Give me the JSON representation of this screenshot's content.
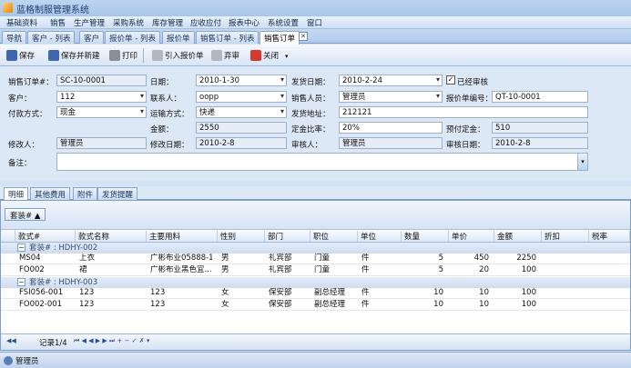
{
  "app": {
    "title": "蓝格制服管理系统"
  },
  "menu": [
    "基础资料",
    "销售",
    "生产管理",
    "采购系统",
    "库存管理",
    "应收应付",
    "报表中心",
    "系统设置",
    "窗口"
  ],
  "tabs": [
    "导航",
    "客户 - 列表",
    "客户",
    "报价单 - 列表",
    "报价单",
    "销售订单 - 列表",
    "销售订单"
  ],
  "toolbar": {
    "save": "保存",
    "save_new": "保存并新建",
    "print": "打印",
    "import_quote": "引入报价单",
    "audit": "弃审",
    "close": "关闭"
  },
  "form": {
    "order_no_label": "销售订单#：",
    "order_no": "SC-10-0001",
    "date_label": "日期：",
    "date": "2010-1-30",
    "ship_date_label": "发货日期：",
    "ship_date": "2010-2-24",
    "audited_label": "已经审核",
    "audited_check": "✓",
    "customer_label": "客户：",
    "customer": "112",
    "contact_label": "联系人：",
    "contact": "oopp",
    "salesman_label": "销售人员：",
    "salesman": "管理员",
    "quote_no_label": "报价单编号：",
    "quote_no": "QT-10-0001",
    "payment_label": "付款方式：",
    "payment": "现金",
    "transport_label": "运输方式：",
    "transport": "快递",
    "ship_addr_label": "发货地址：",
    "ship_addr": "212121",
    "amount_label": "金额：",
    "amount": "2550",
    "deposit_ratio_label": "定金比率：",
    "deposit_ratio": "20%",
    "prepaid_label": "预付定金：",
    "prepaid": "510",
    "modifier_label": "修改人：",
    "modifier": "管理员",
    "modify_date_label": "修改日期：",
    "modify_date": "2010-2-8",
    "auditor_label": "审核人：",
    "auditor": "管理员",
    "audit_date_label": "审核日期：",
    "audit_date": "2010-2-8",
    "remark_label": "备注："
  },
  "subtabs": [
    "明细",
    "其他费用",
    "附件",
    "发货提醒"
  ],
  "grid": {
    "group_chip": "套装# ▲",
    "columns": [
      "款式#",
      "款式名称",
      "主要用料",
      "性别",
      "部门",
      "职位",
      "单位",
      "数量",
      "单价",
      "金额",
      "折扣",
      "税率"
    ],
    "groups": [
      {
        "label": "套装# : HDHY-002",
        "rows": [
          [
            "MS04",
            "上衣",
            "广彬布业05888-1...",
            "男",
            "礼宾部",
            "门童",
            "件",
            "5",
            "450",
            "2250",
            "",
            ""
          ],
          [
            "FO002",
            "裙",
            "广彬布业黑色宜...",
            "男",
            "礼宾部",
            "门童",
            "件",
            "5",
            "20",
            "100",
            "",
            ""
          ]
        ]
      },
      {
        "label": "套装# : HDHY-003",
        "rows": [
          [
            "FSI056-001",
            "123",
            "123",
            "女",
            "保安部",
            "副总经理",
            "件",
            "10",
            "10",
            "100",
            "",
            ""
          ],
          [
            "FO002-001",
            "123",
            "123",
            "女",
            "保安部",
            "副总经理",
            "件",
            "10",
            "10",
            "100",
            "",
            ""
          ]
        ]
      }
    ],
    "nav_record": "记录1/4",
    "nav_buttons": "⏮ ◀ ◀ ▶ ▶ ⏭ + − ✓ ✗ ▾"
  },
  "status": {
    "user": "管理员"
  }
}
